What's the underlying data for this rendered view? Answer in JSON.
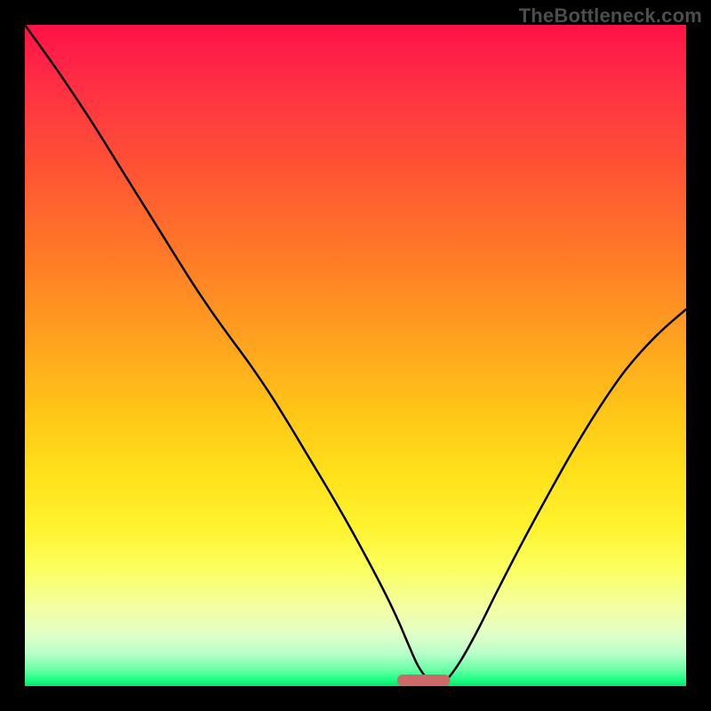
{
  "watermark": "TheBottleneck.com",
  "marker": {
    "color": "#cc6a6a",
    "x_center": 0.603,
    "y": 0.0,
    "half_width": 0.04,
    "rx": 6
  },
  "chart_data": {
    "type": "line",
    "title": "",
    "xlabel": "",
    "ylabel": "",
    "xlim": [
      0,
      1
    ],
    "ylim": [
      0,
      1
    ],
    "series": [
      {
        "name": "bottleneck-curve",
        "x": [
          0.0,
          0.05,
          0.1,
          0.15,
          0.2,
          0.25,
          0.28,
          0.31,
          0.34,
          0.37,
          0.4,
          0.43,
          0.46,
          0.49,
          0.52,
          0.545,
          0.565,
          0.58,
          0.595,
          0.61,
          0.625,
          0.64,
          0.66,
          0.685,
          0.715,
          0.75,
          0.79,
          0.83,
          0.87,
          0.91,
          0.955,
          1.0
        ],
        "y": [
          1.0,
          0.93,
          0.855,
          0.775,
          0.695,
          0.615,
          0.57,
          0.528,
          0.487,
          0.443,
          0.395,
          0.345,
          0.295,
          0.243,
          0.188,
          0.14,
          0.098,
          0.063,
          0.03,
          0.01,
          0.0,
          0.012,
          0.04,
          0.085,
          0.145,
          0.213,
          0.287,
          0.358,
          0.423,
          0.48,
          0.53,
          0.57
        ]
      }
    ]
  }
}
